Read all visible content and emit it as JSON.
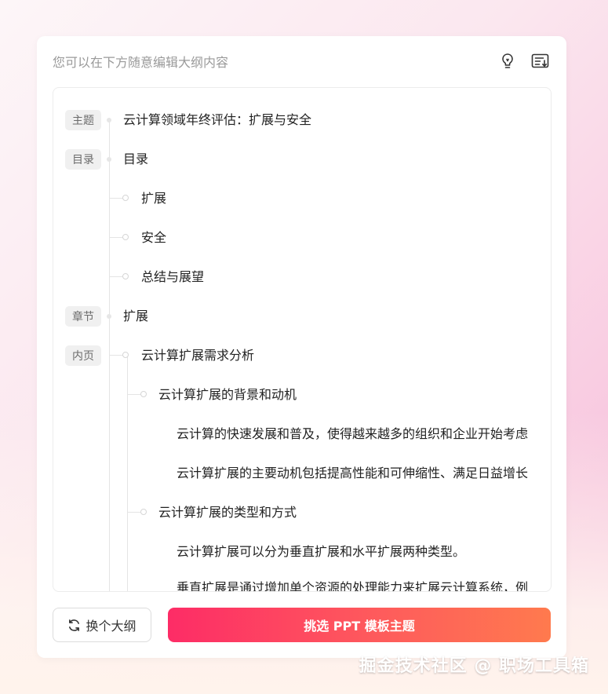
{
  "header": {
    "hint": "您可以在下方随意编辑大纲内容",
    "icons": [
      "lightbulb-icon",
      "list-export-icon"
    ]
  },
  "outline": {
    "badges": {
      "topic": "主题",
      "toc": "目录",
      "chapter": "章节",
      "page": "内页"
    },
    "topic_text": "云计算领域年终评估：扩展与安全",
    "toc_text": "目录",
    "toc_items": [
      "扩展",
      "安全",
      "总结与展望"
    ],
    "chapter_text": "扩展",
    "page_title": "云计算扩展需求分析",
    "sections": [
      {
        "title": "云计算扩展的背景和动机",
        "paragraphs": [
          "云计算的快速发展和普及，使得越来越多的组织和企业开始考虑",
          "云计算扩展的主要动机包括提高性能和可伸缩性、满足日益增长"
        ]
      },
      {
        "title": "云计算扩展的类型和方式",
        "paragraphs": [
          "云计算扩展可以分为垂直扩展和水平扩展两种类型。",
          "垂直扩展是通过增加单个资源的处理能力来扩展云计算系统，例"
        ]
      }
    ]
  },
  "footer": {
    "change_outline": "换个大纲",
    "pick_template": "挑选 PPT 模板主题"
  },
  "watermark": "掘金技术社区 @ 职场工具箱",
  "colors": {
    "accent_start": "#fd2c66",
    "accent_end": "#ff7a4e"
  }
}
